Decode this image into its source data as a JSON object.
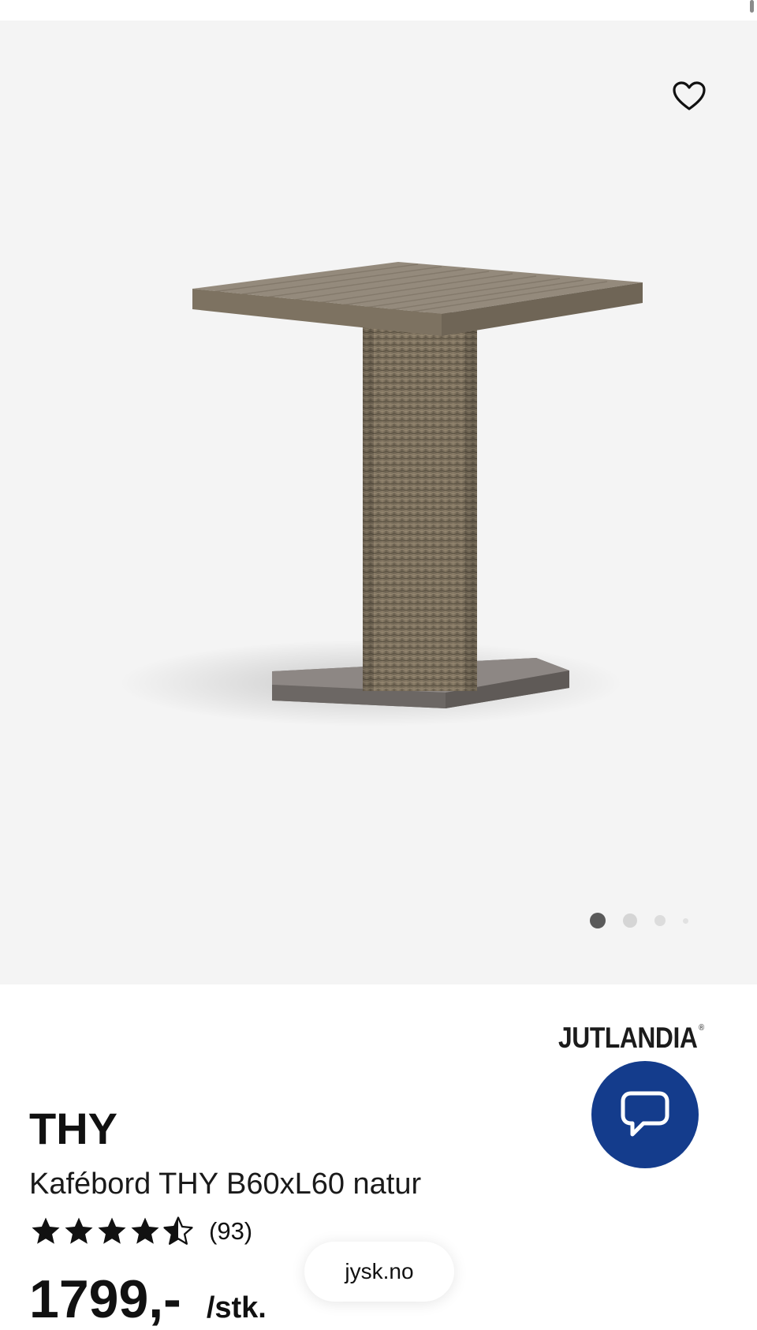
{
  "gallery": {
    "favorite_icon": "heart-outline-icon",
    "image_alt": "Kafébord THY B60xL60 natur",
    "dots": {
      "count": 4,
      "active": 1
    }
  },
  "brand_logo": {
    "text": "JUTLANDIA",
    "mark": "®"
  },
  "chat": {
    "icon": "speech-bubble-icon",
    "color": "#143c8c"
  },
  "product": {
    "brand": "THY",
    "name": "Kafébord THY B60xL60 natur",
    "rating": {
      "value": 4.5,
      "max": 5,
      "count_text": "(93)"
    },
    "price": "1799,-",
    "unit": "/stk."
  },
  "browser": {
    "url": "jysk.no"
  }
}
